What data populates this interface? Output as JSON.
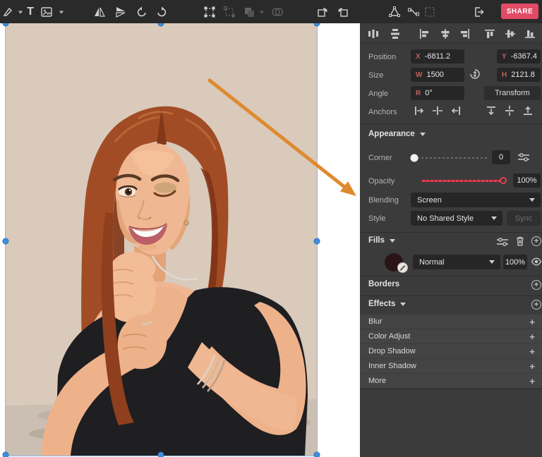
{
  "toolbar": {
    "share_label": "SHARE",
    "text_tool_label": "T",
    "icons": [
      "pen-tool",
      "text-tool",
      "image-tool",
      "flip-horizontal",
      "flip-vertical",
      "rotate-ccw",
      "rotate-cw",
      "group",
      "ungroup",
      "arrange",
      "boolean-ops",
      "rotate-object-left",
      "rotate-object-right",
      "path-tool",
      "connector-tool",
      "marquee-tool",
      "export"
    ]
  },
  "canvas": {
    "selection": "artboard with winking red-haired woman illustration",
    "annotation_arrow_color": "#df8a2e",
    "artboard_bg": "#d9cabc"
  },
  "panel": {
    "align_icons": [
      "distribute-horizontal",
      "distribute-vertical",
      "align-left",
      "align-center-h",
      "align-right",
      "align-top",
      "align-middle-v",
      "align-bottom"
    ],
    "position": {
      "label": "Position",
      "x_prefix": "X",
      "x": "-6811.2",
      "y_prefix": "Y",
      "y": "-6367.4"
    },
    "size": {
      "label": "Size",
      "w_prefix": "W",
      "w": "1500",
      "h_prefix": "H",
      "h": "2121.8"
    },
    "angle": {
      "label": "Angle",
      "r_prefix": "R",
      "value": "0°",
      "transform_label": "Transform"
    },
    "anchors_label": "Anchors",
    "appearance": {
      "title": "Appearance",
      "corner_label": "Corner",
      "corner_value": "0",
      "opacity_label": "Opacity",
      "opacity_value": "100%",
      "blending_label": "Blending",
      "blending_value": "Screen",
      "style_label": "Style",
      "style_value": "No Shared Style",
      "sync_label": "Sync"
    },
    "fills": {
      "title": "Fills",
      "blend_value": "Normal",
      "opacity_value": "100%",
      "swatch_color": "#2a1418"
    },
    "borders": {
      "title": "Borders"
    },
    "effects": {
      "title": "Effects",
      "items": [
        "Blur",
        "Color Adjust",
        "Drop Shadow",
        "Inner Shadow",
        "More"
      ]
    }
  },
  "colors": {
    "accent_pink": "#e14b66",
    "accent_orange": "#df8a2e",
    "selection_blue": "#3f8fe0",
    "prefix_red": "#c0625c",
    "opacity_red": "#e83a52"
  }
}
